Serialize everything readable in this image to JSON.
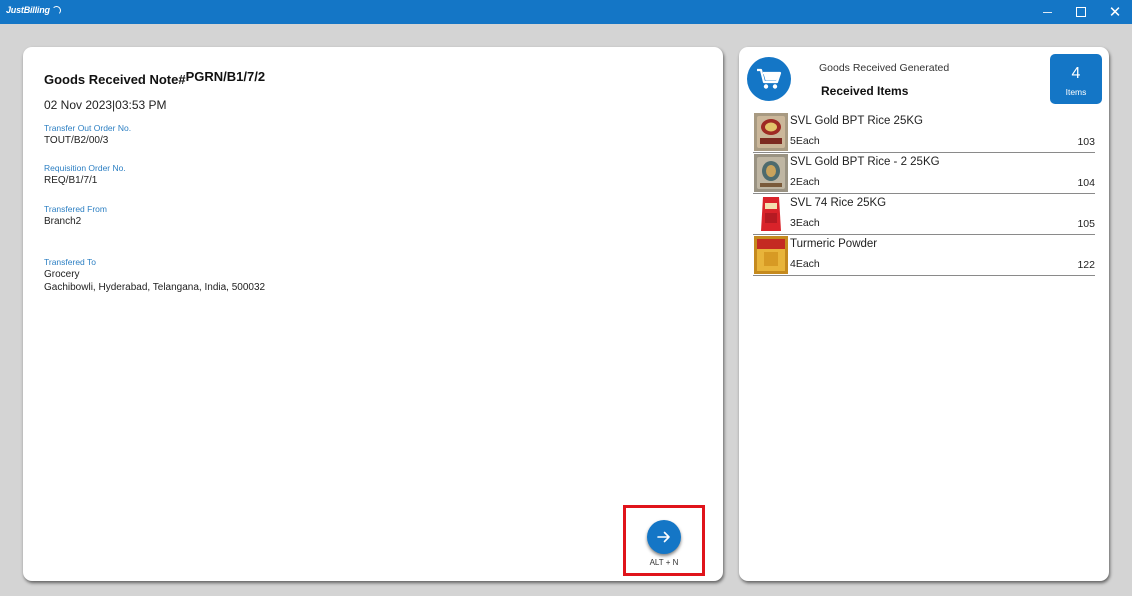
{
  "window": {
    "app_name": "JustBilling"
  },
  "note": {
    "title_prefix": "Goods Received Note#",
    "number": "PGRN/B1/7/2",
    "date": "02 Nov 2023|03:53 PM",
    "fields": [
      {
        "label": "Transfer Out Order No.",
        "value": "TOUT/B2/00/3"
      },
      {
        "label": "Requisition Order No.",
        "value": "REQ/B1/7/1"
      },
      {
        "label": "Transfered From",
        "value": "Branch2"
      },
      {
        "label": "Transfered To",
        "value": "Grocery",
        "value2": "Gachibowli, Hyderabad, Telangana, India, 500032"
      }
    ],
    "next_shortcut": "ALT + N"
  },
  "summary": {
    "generated_label": "Goods Received Generated",
    "received_label": "Received Items",
    "count": "4",
    "count_label": "Items"
  },
  "items": [
    {
      "name": "SVL Gold BPT Rice 25KG",
      "qty": "5Each",
      "num": "103"
    },
    {
      "name": "SVL Gold BPT Rice - 2 25KG",
      "qty": "2Each",
      "num": "104"
    },
    {
      "name": "SVL  74 Rice 25KG",
      "qty": "3Each",
      "num": "105"
    },
    {
      "name": "Turmeric Powder",
      "qty": "4Each",
      "num": "122"
    }
  ],
  "colors": {
    "accent": "#1476c6",
    "highlight": "#e0141b",
    "background": "#d4d4d4"
  }
}
